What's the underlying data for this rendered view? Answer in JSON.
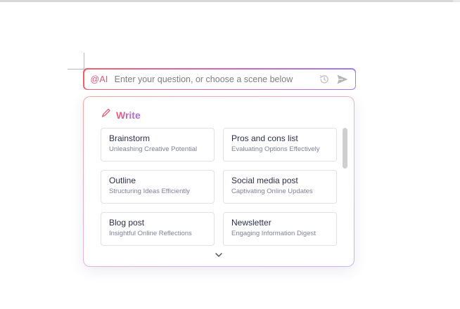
{
  "ai_bar": {
    "prefix": "@AI",
    "placeholder": "Enter your question, or choose a scene below",
    "history_icon": "history-icon",
    "send_icon": "send-icon"
  },
  "panel": {
    "title": "Write",
    "title_icon": "pen-icon",
    "expand_icon": "chevron-down-icon",
    "scenes": [
      {
        "title": "Brainstorm",
        "subtitle": "Unleashing Creative Potential"
      },
      {
        "title": "Pros and cons list",
        "subtitle": "Evaluating Options Effectively"
      },
      {
        "title": "Outline",
        "subtitle": "Structuring Ideas Efficiently"
      },
      {
        "title": "Social media post",
        "subtitle": "Captivating Online Updates"
      },
      {
        "title": "Blog post",
        "subtitle": "Insightful Online Reflections"
      },
      {
        "title": "Newsletter",
        "subtitle": "Engaging Information Digest"
      }
    ]
  },
  "colors": {
    "accent_start": "#f0616c",
    "accent_end": "#9b7cf2",
    "card_border": "#e1e1ee",
    "title_text": "#2b2f4a",
    "subtitle_text": "#7f8197"
  }
}
